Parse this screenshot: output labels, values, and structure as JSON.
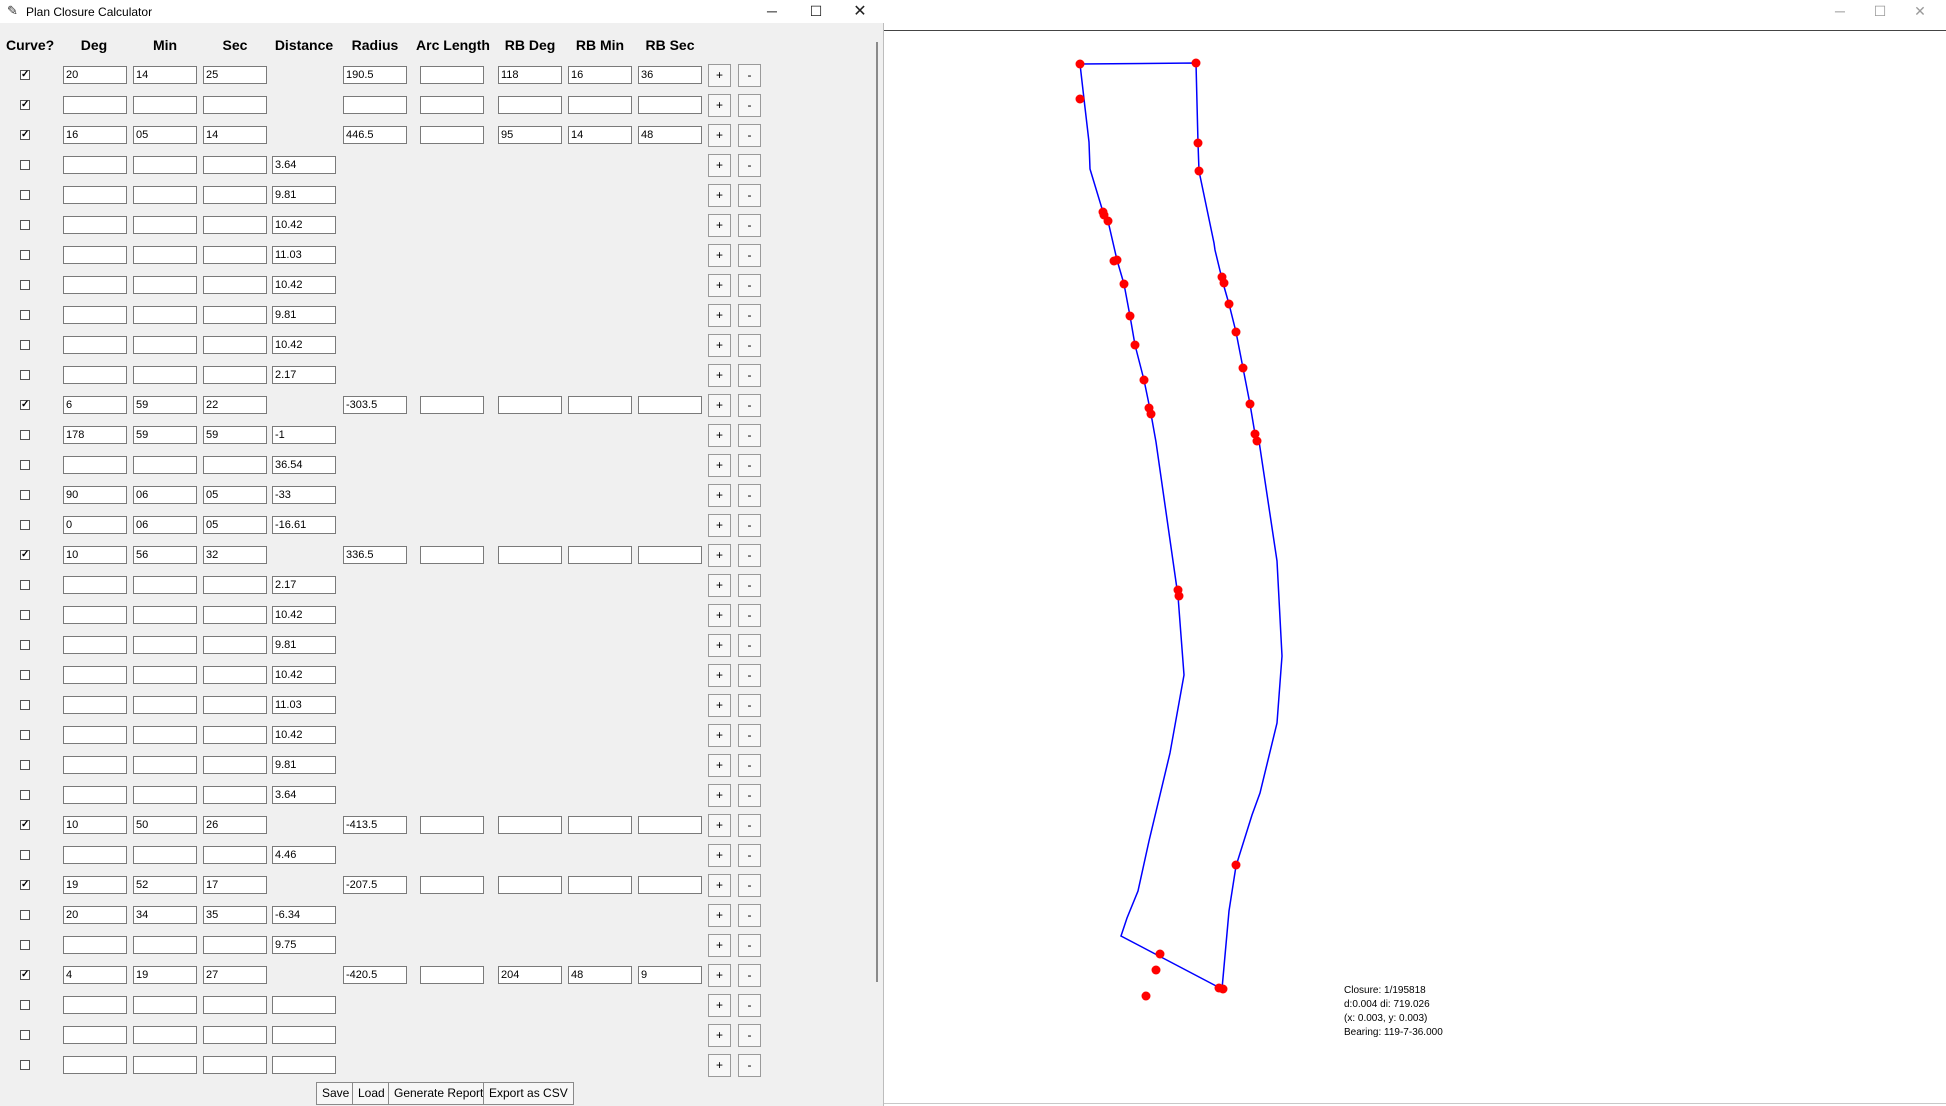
{
  "window": {
    "title": "Plan Closure Calculator",
    "min_symbol": "─",
    "max_symbol": "☐",
    "close_symbol": "✕"
  },
  "headers": [
    "Curve?",
    "Deg",
    "Min",
    "Sec",
    "Distance",
    "Radius",
    "Arc Length",
    "RB Deg",
    "RB Min",
    "RB Sec"
  ],
  "rows": [
    {
      "curve": true,
      "deg": "20",
      "min": "14",
      "sec": "25",
      "distance": "",
      "radius": "190.5",
      "arc": "",
      "rbdeg": "118",
      "rbmin": "16",
      "rbsec": "36"
    },
    {
      "curve": true,
      "deg": "",
      "min": "",
      "sec": "",
      "distance": "",
      "radius": "",
      "arc": "",
      "rbdeg": "",
      "rbmin": "",
      "rbsec": ""
    },
    {
      "curve": true,
      "deg": "16",
      "min": "05",
      "sec": "14",
      "distance": "",
      "radius": "446.5",
      "arc": "",
      "rbdeg": "95",
      "rbmin": "14",
      "rbsec": "48"
    },
    {
      "curve": false,
      "deg": "",
      "min": "",
      "sec": "",
      "distance": "3.64"
    },
    {
      "curve": false,
      "deg": "",
      "min": "",
      "sec": "",
      "distance": "9.81"
    },
    {
      "curve": false,
      "deg": "",
      "min": "",
      "sec": "",
      "distance": "10.42"
    },
    {
      "curve": false,
      "deg": "",
      "min": "",
      "sec": "",
      "distance": "11.03"
    },
    {
      "curve": false,
      "deg": "",
      "min": "",
      "sec": "",
      "distance": "10.42"
    },
    {
      "curve": false,
      "deg": "",
      "min": "",
      "sec": "",
      "distance": "9.81"
    },
    {
      "curve": false,
      "deg": "",
      "min": "",
      "sec": "",
      "distance": "10.42"
    },
    {
      "curve": false,
      "deg": "",
      "min": "",
      "sec": "",
      "distance": "2.17"
    },
    {
      "curve": true,
      "deg": "6",
      "min": "59",
      "sec": "22",
      "distance": "",
      "radius": "-303.5",
      "arc": "",
      "rbdeg": "",
      "rbmin": "",
      "rbsec": ""
    },
    {
      "curve": false,
      "deg": "178",
      "min": "59",
      "sec": "59",
      "distance": "-1"
    },
    {
      "curve": false,
      "deg": "",
      "min": "",
      "sec": "",
      "distance": "36.54"
    },
    {
      "curve": false,
      "deg": "90",
      "min": "06",
      "sec": "05",
      "distance": "-33"
    },
    {
      "curve": false,
      "deg": "0",
      "min": "06",
      "sec": "05",
      "distance": "-16.61"
    },
    {
      "curve": true,
      "deg": "10",
      "min": "56",
      "sec": "32",
      "distance": "",
      "radius": "336.5",
      "arc": "",
      "rbdeg": "",
      "rbmin": "",
      "rbsec": ""
    },
    {
      "curve": false,
      "deg": "",
      "min": "",
      "sec": "",
      "distance": "2.17"
    },
    {
      "curve": false,
      "deg": "",
      "min": "",
      "sec": "",
      "distance": "10.42"
    },
    {
      "curve": false,
      "deg": "",
      "min": "",
      "sec": "",
      "distance": "9.81"
    },
    {
      "curve": false,
      "deg": "",
      "min": "",
      "sec": "",
      "distance": "10.42"
    },
    {
      "curve": false,
      "deg": "",
      "min": "",
      "sec": "",
      "distance": "11.03"
    },
    {
      "curve": false,
      "deg": "",
      "min": "",
      "sec": "",
      "distance": "10.42"
    },
    {
      "curve": false,
      "deg": "",
      "min": "",
      "sec": "",
      "distance": "9.81"
    },
    {
      "curve": false,
      "deg": "",
      "min": "",
      "sec": "",
      "distance": "3.64"
    },
    {
      "curve": true,
      "deg": "10",
      "min": "50",
      "sec": "26",
      "distance": "",
      "radius": "-413.5",
      "arc": "",
      "rbdeg": "",
      "rbmin": "",
      "rbsec": ""
    },
    {
      "curve": false,
      "deg": "",
      "min": "",
      "sec": "",
      "distance": "4.46"
    },
    {
      "curve": true,
      "deg": "19",
      "min": "52",
      "sec": "17",
      "distance": "",
      "radius": "-207.5",
      "arc": "",
      "rbdeg": "",
      "rbmin": "",
      "rbsec": ""
    },
    {
      "curve": false,
      "deg": "20",
      "min": "34",
      "sec": "35",
      "distance": "-6.34"
    },
    {
      "curve": false,
      "deg": "",
      "min": "",
      "sec": "",
      "distance": "9.75"
    },
    {
      "curve": true,
      "deg": "4",
      "min": "19",
      "sec": "27",
      "distance": "",
      "radius": "-420.5",
      "arc": "",
      "rbdeg": "204",
      "rbmin": "48",
      "rbsec": "9"
    },
    {
      "curve": false,
      "deg": "",
      "min": "",
      "sec": "",
      "distance": ""
    },
    {
      "curve": false,
      "deg": "",
      "min": "",
      "sec": "",
      "distance": ""
    },
    {
      "curve": false,
      "deg": "",
      "min": "",
      "sec": "",
      "distance": ""
    }
  ],
  "row_buttons": {
    "add": "+",
    "remove": "-"
  },
  "bottom_buttons": [
    "Save",
    "Load",
    "Generate Report",
    "Export as CSV"
  ],
  "plot": {
    "annotation": [
      "Closure: 1/195818",
      "d:0.004 di: 719.026",
      "(x: 0.003, y: 0.003)",
      "Bearing: 119-7-36.000"
    ],
    "colors": {
      "line": "#0000ff",
      "point": "#ff0000"
    }
  }
}
